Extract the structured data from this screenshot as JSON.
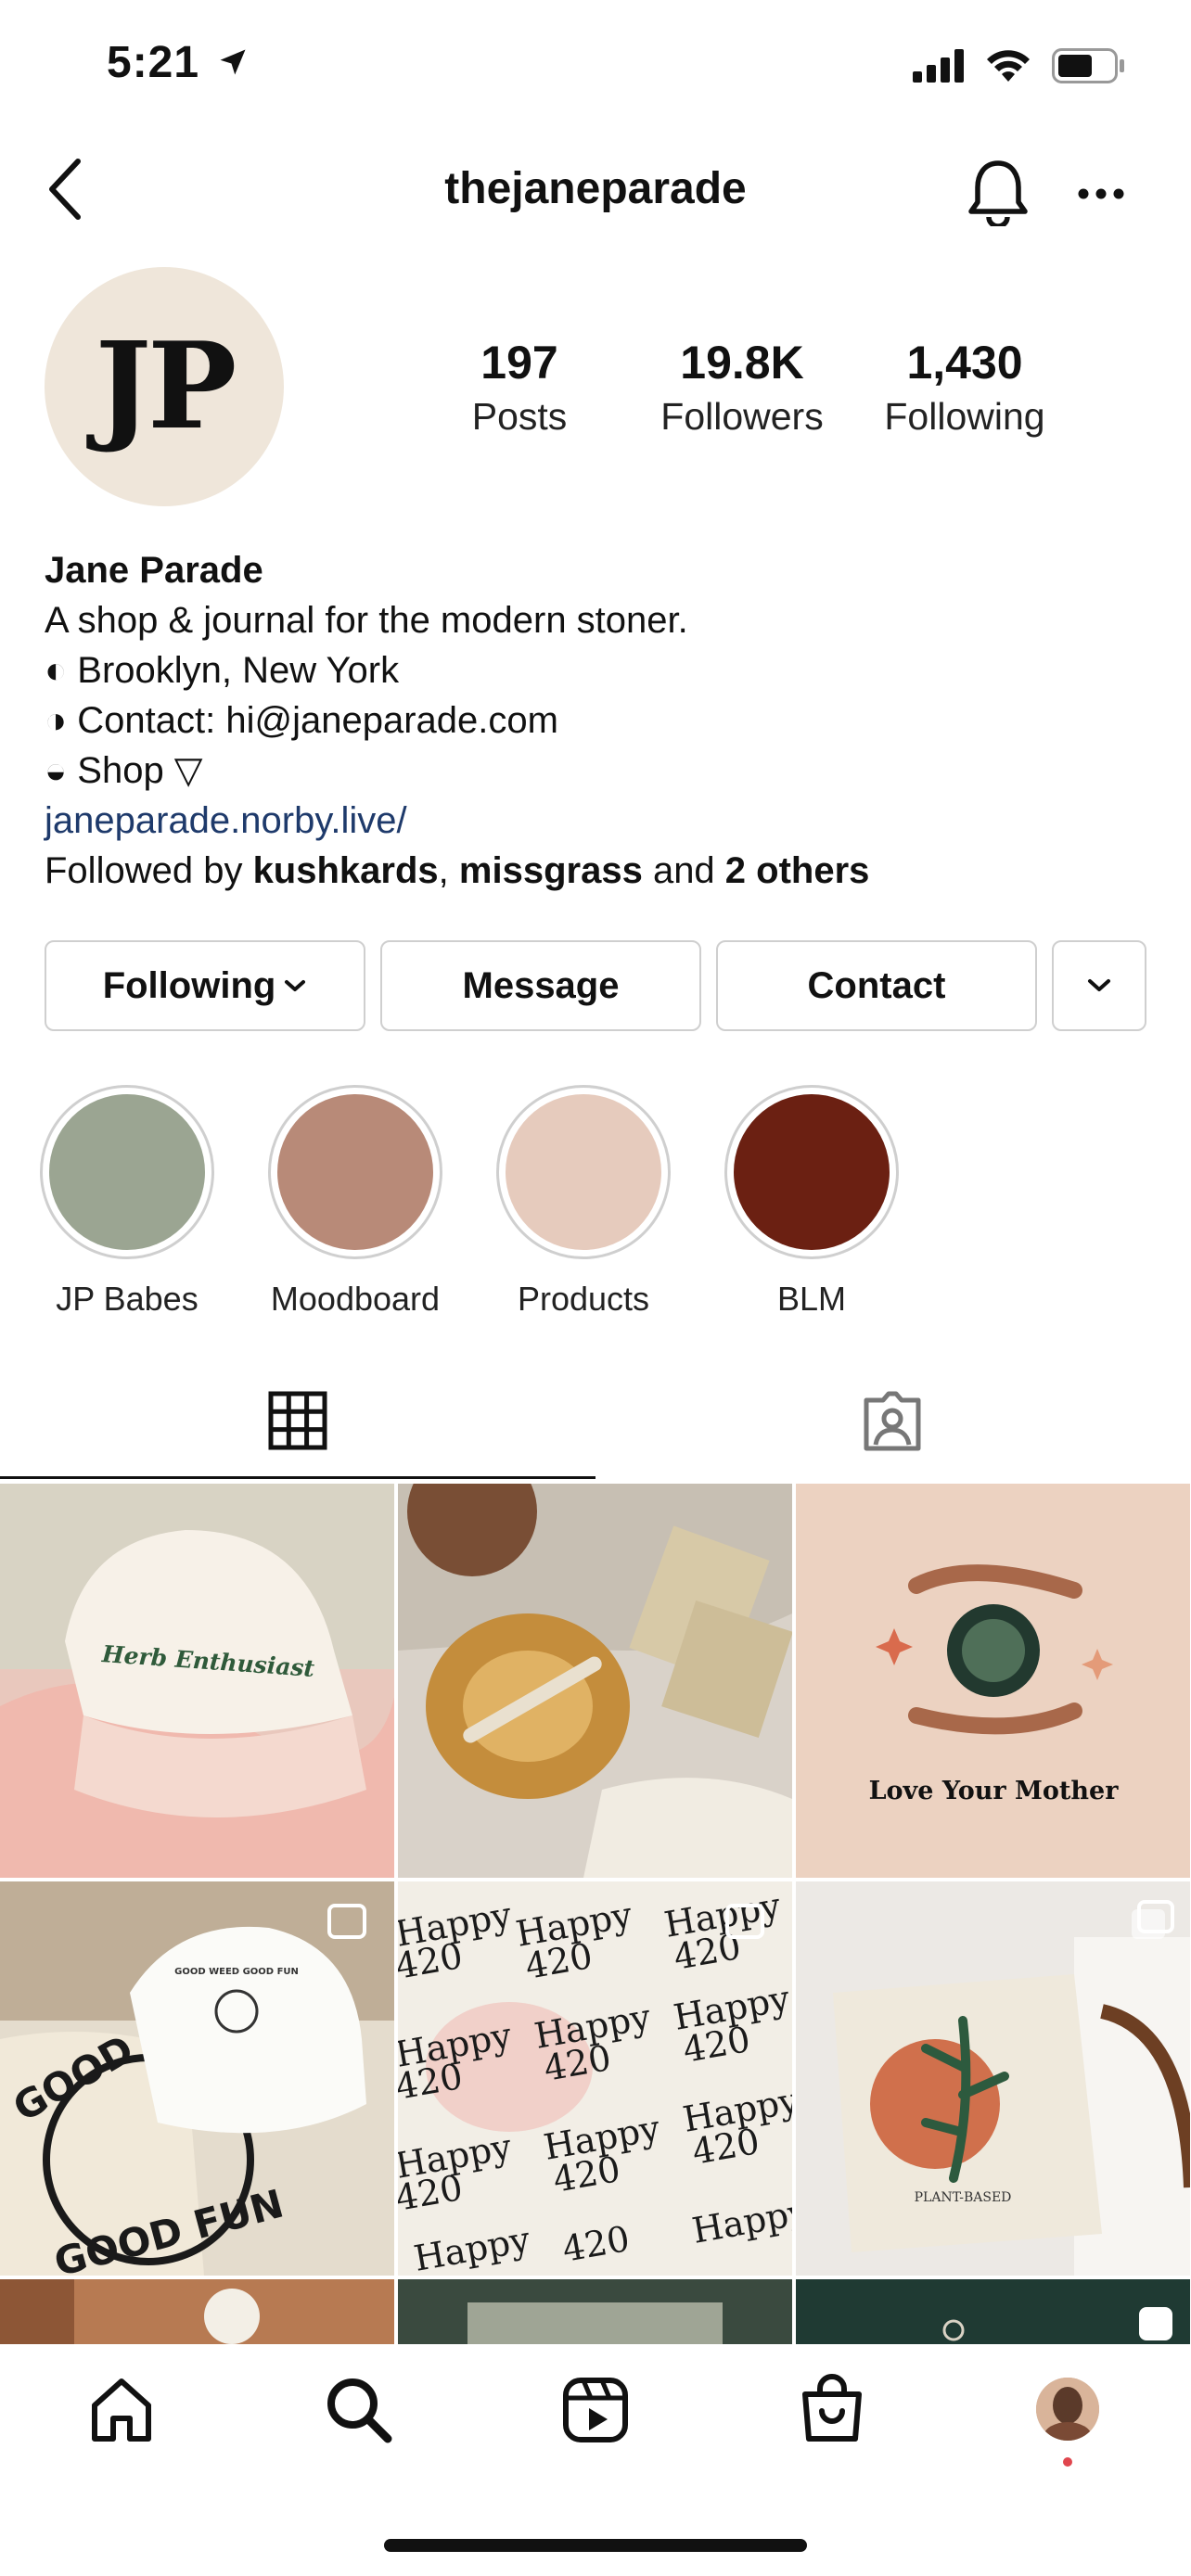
{
  "status_bar": {
    "time": "5:21"
  },
  "header": {
    "title": "thejaneparade"
  },
  "profile": {
    "avatar_text": "JP",
    "stats": [
      {
        "value": "197",
        "label": "Posts"
      },
      {
        "value": "19.8K",
        "label": "Followers"
      },
      {
        "value": "1,430",
        "label": "Following"
      }
    ],
    "name": "Jane Parade",
    "bio_lines": [
      "A shop & journal for the modern stoner.",
      "◐ Brooklyn, New York",
      "◑ Contact: hi@janeparade.com",
      "◒ Shop ▽"
    ],
    "link": "janeparade.norby.live/",
    "followed_by": {
      "prefix": "Followed by ",
      "user1": "kushkards",
      "sep": ", ",
      "user2": "missgrass",
      "mid": " and ",
      "others": "2 others"
    }
  },
  "actions": {
    "following": "Following",
    "message": "Message",
    "contact": "Contact"
  },
  "highlights": [
    {
      "label": "JP Babes",
      "color": "#9ba592"
    },
    {
      "label": "Moodboard",
      "color": "#b88a78"
    },
    {
      "label": "Products",
      "color": "#e6cbbd"
    },
    {
      "label": "BLM",
      "color": "#6b2012"
    }
  ],
  "posts": {
    "cap_text": "Herb Enthusiast",
    "mother_text": "Love Your Mother",
    "tote_text": "GOOD FUN",
    "tote_text2": "GOOD",
    "hat_text": "GOOD WEED GOOD FUN",
    "happy_word": "Happy",
    "happy_num": "420",
    "plant_text": "PLANT-BASED"
  },
  "colors": {
    "link": "#1e3a6b",
    "border": "#cfcfcf",
    "notification_dot": "#e0464e"
  }
}
